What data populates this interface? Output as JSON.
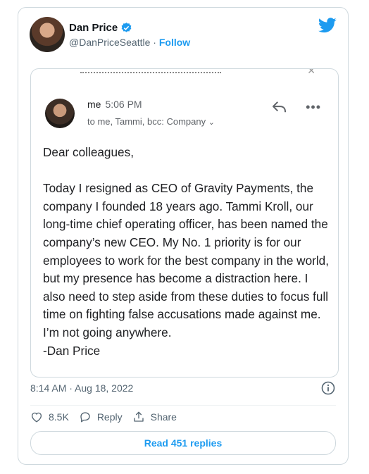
{
  "author": {
    "name": "Dan Price",
    "handle": "@DanPriceSeattle",
    "separator": " · ",
    "follow_label": "Follow"
  },
  "email": {
    "sender": "me",
    "time": "5:06 PM",
    "recipients": "to me, Tammi, bcc: Company",
    "body": "Dear colleagues,\n\nToday I resigned as CEO of Gravity Payments, the company I founded 18 years ago. Tammi Kroll, our long-time chief operating officer, has been named the company’s new CEO. My No. 1 priority is for our employees to work for the best company in the world, but my presence has become a distraction here. I also need to step aside from these duties to focus full time on fighting false accusations made against me. I’m not going anywhere.\n-Dan Price",
    "more_icon": "•••"
  },
  "tweet": {
    "timestamp": "8:14 AM · Aug 18, 2022",
    "likes": "8.5K",
    "reply_label": "Reply",
    "share_label": "Share",
    "read_replies": "Read 451 replies"
  },
  "colors": {
    "accent": "#1d9bf0",
    "muted": "#536471",
    "border": "#cfd9de"
  }
}
